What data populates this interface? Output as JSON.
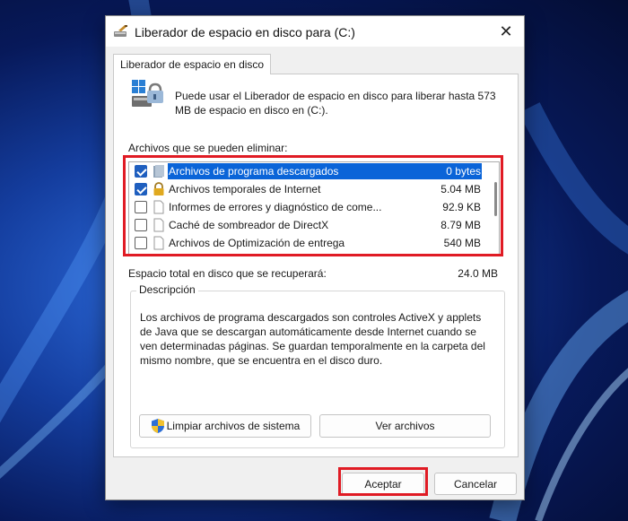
{
  "window": {
    "title": "Liberador de espacio en disco para  (C:)",
    "close_glyph": "✕"
  },
  "tab": {
    "label": "Liberador de espacio en disco"
  },
  "intro_text": "Puede usar el Liberador de espacio en disco para liberar hasta 573 MB de espacio en disco en  (C:).",
  "files_label": "Archivos que se pueden eliminar:",
  "files": [
    {
      "name": "Archivos de programa descargados",
      "size": "0 bytes",
      "checked": true,
      "selected": true,
      "icon": "folder-icon"
    },
    {
      "name": "Archivos temporales de Internet",
      "size": "5.04 MB",
      "checked": true,
      "selected": false,
      "icon": "lock-icon"
    },
    {
      "name": "Informes de errores y diagnóstico de come...",
      "size": "92.9 KB",
      "checked": false,
      "selected": false,
      "icon": "file-icon"
    },
    {
      "name": "Caché de sombreador de DirectX",
      "size": "8.79 MB",
      "checked": false,
      "selected": false,
      "icon": "file-icon"
    },
    {
      "name": "Archivos de Optimización de entrega",
      "size": "540 MB",
      "checked": false,
      "selected": false,
      "icon": "file-icon"
    }
  ],
  "total_label": "Espacio total en disco que se recuperará:",
  "total_value": "24.0 MB",
  "description": {
    "legend": "Descripción",
    "text": "Los archivos de programa descargados son controles ActiveX y applets de Java que se descargan automáticamente desde Internet cuando se ven determinadas páginas. Se guardan temporalmente en la carpeta del mismo nombre, que se encuentra en el disco duro."
  },
  "buttons": {
    "cleanup_system": "Limpiar archivos de sistema",
    "view_files": "Ver archivos",
    "ok": "Aceptar",
    "cancel": "Cancelar"
  },
  "colors": {
    "highlight_red": "#e01b24",
    "selection_blue": "#0a64d8",
    "checkbox_blue": "#1f5fbf"
  }
}
